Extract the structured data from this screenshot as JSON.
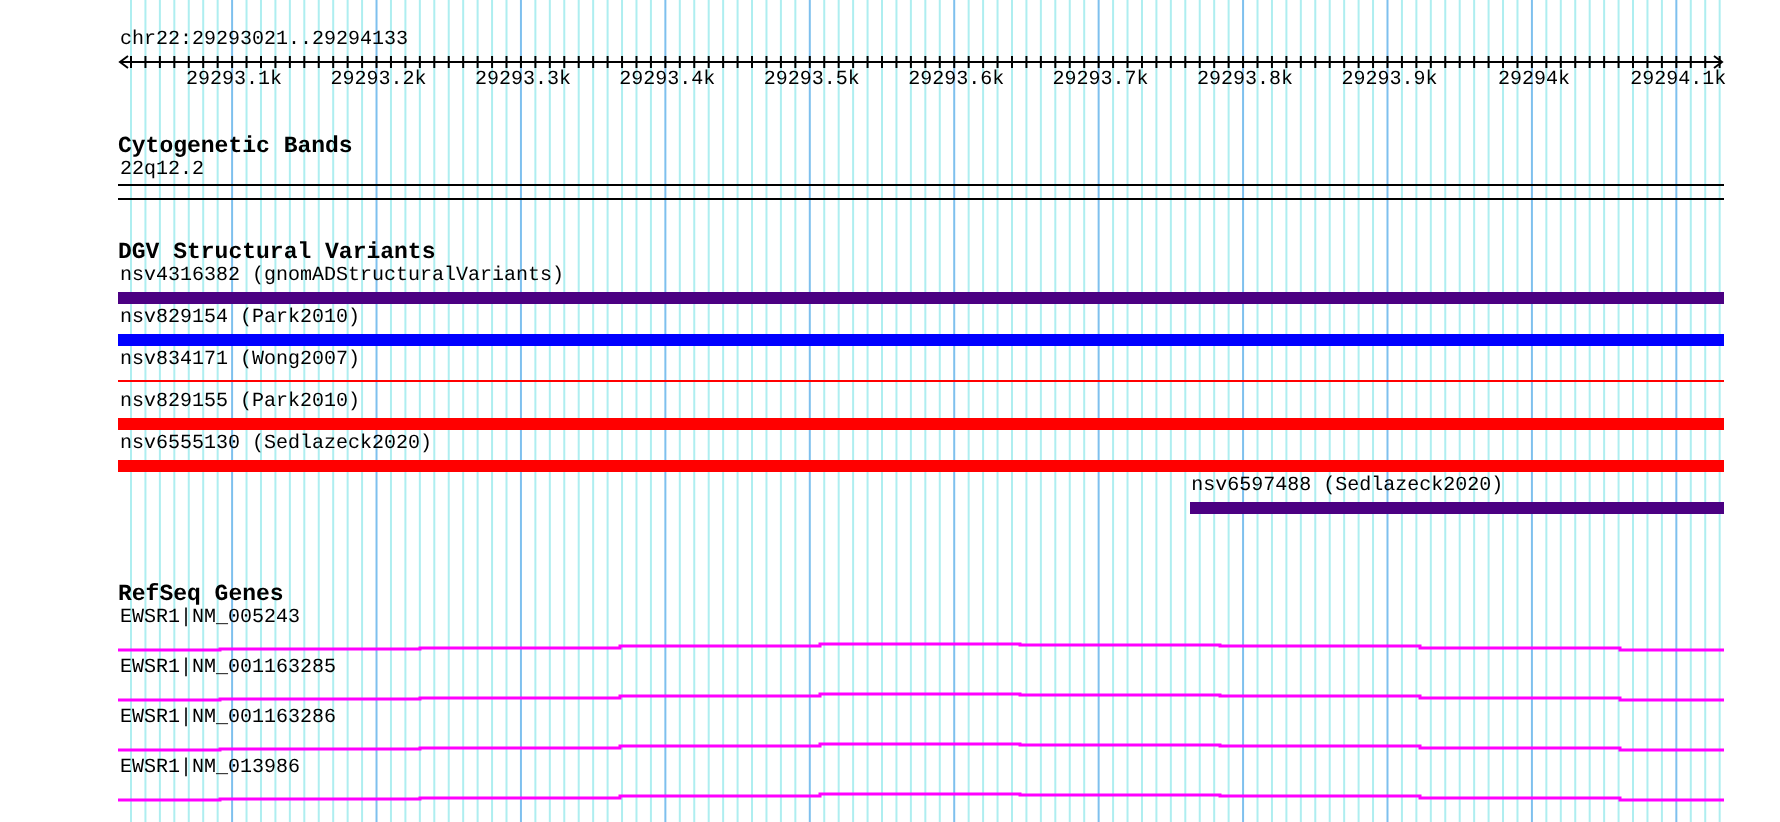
{
  "ruler": {
    "location": "chr22:29293021..29294133",
    "ticks": [
      "29293.1k",
      "29293.2k",
      "29293.3k",
      "29293.4k",
      "29293.5k",
      "29293.6k",
      "29293.7k",
      "29293.8k",
      "29293.9k",
      "29294k",
      "29294.1k"
    ]
  },
  "cytogenetic_bands": {
    "title": "Cytogenetic Bands",
    "features": [
      {
        "label": "22q12.2"
      }
    ]
  },
  "dgv_structural_variants": {
    "title": "DGV Structural Variants",
    "features": [
      {
        "label": "nsv4316382 (gnomADStructuralVariants)",
        "color": "#4b0082",
        "kind": "thick"
      },
      {
        "label": "nsv829154 (Park2010)",
        "color": "#0000ff",
        "kind": "thick"
      },
      {
        "label": "nsv834171 (Wong2007)",
        "color": "#ff0000",
        "kind": "thin"
      },
      {
        "label": "nsv829155 (Park2010)",
        "color": "#ff0000",
        "kind": "thick"
      },
      {
        "label": "nsv6555130 (Sedlazeck2020)",
        "color": "#ff0000",
        "kind": "thick"
      },
      {
        "label": "nsv6597488 (Sedlazeck2020)",
        "color": "#4b0082",
        "kind": "thick"
      }
    ]
  },
  "refseq_genes": {
    "title": "RefSeq Genes",
    "features": [
      {
        "label": "EWSR1|NM_005243"
      },
      {
        "label": "EWSR1|NM_001163285"
      },
      {
        "label": "EWSR1|NM_001163286"
      },
      {
        "label": "EWSR1|NM_013986"
      }
    ]
  }
}
